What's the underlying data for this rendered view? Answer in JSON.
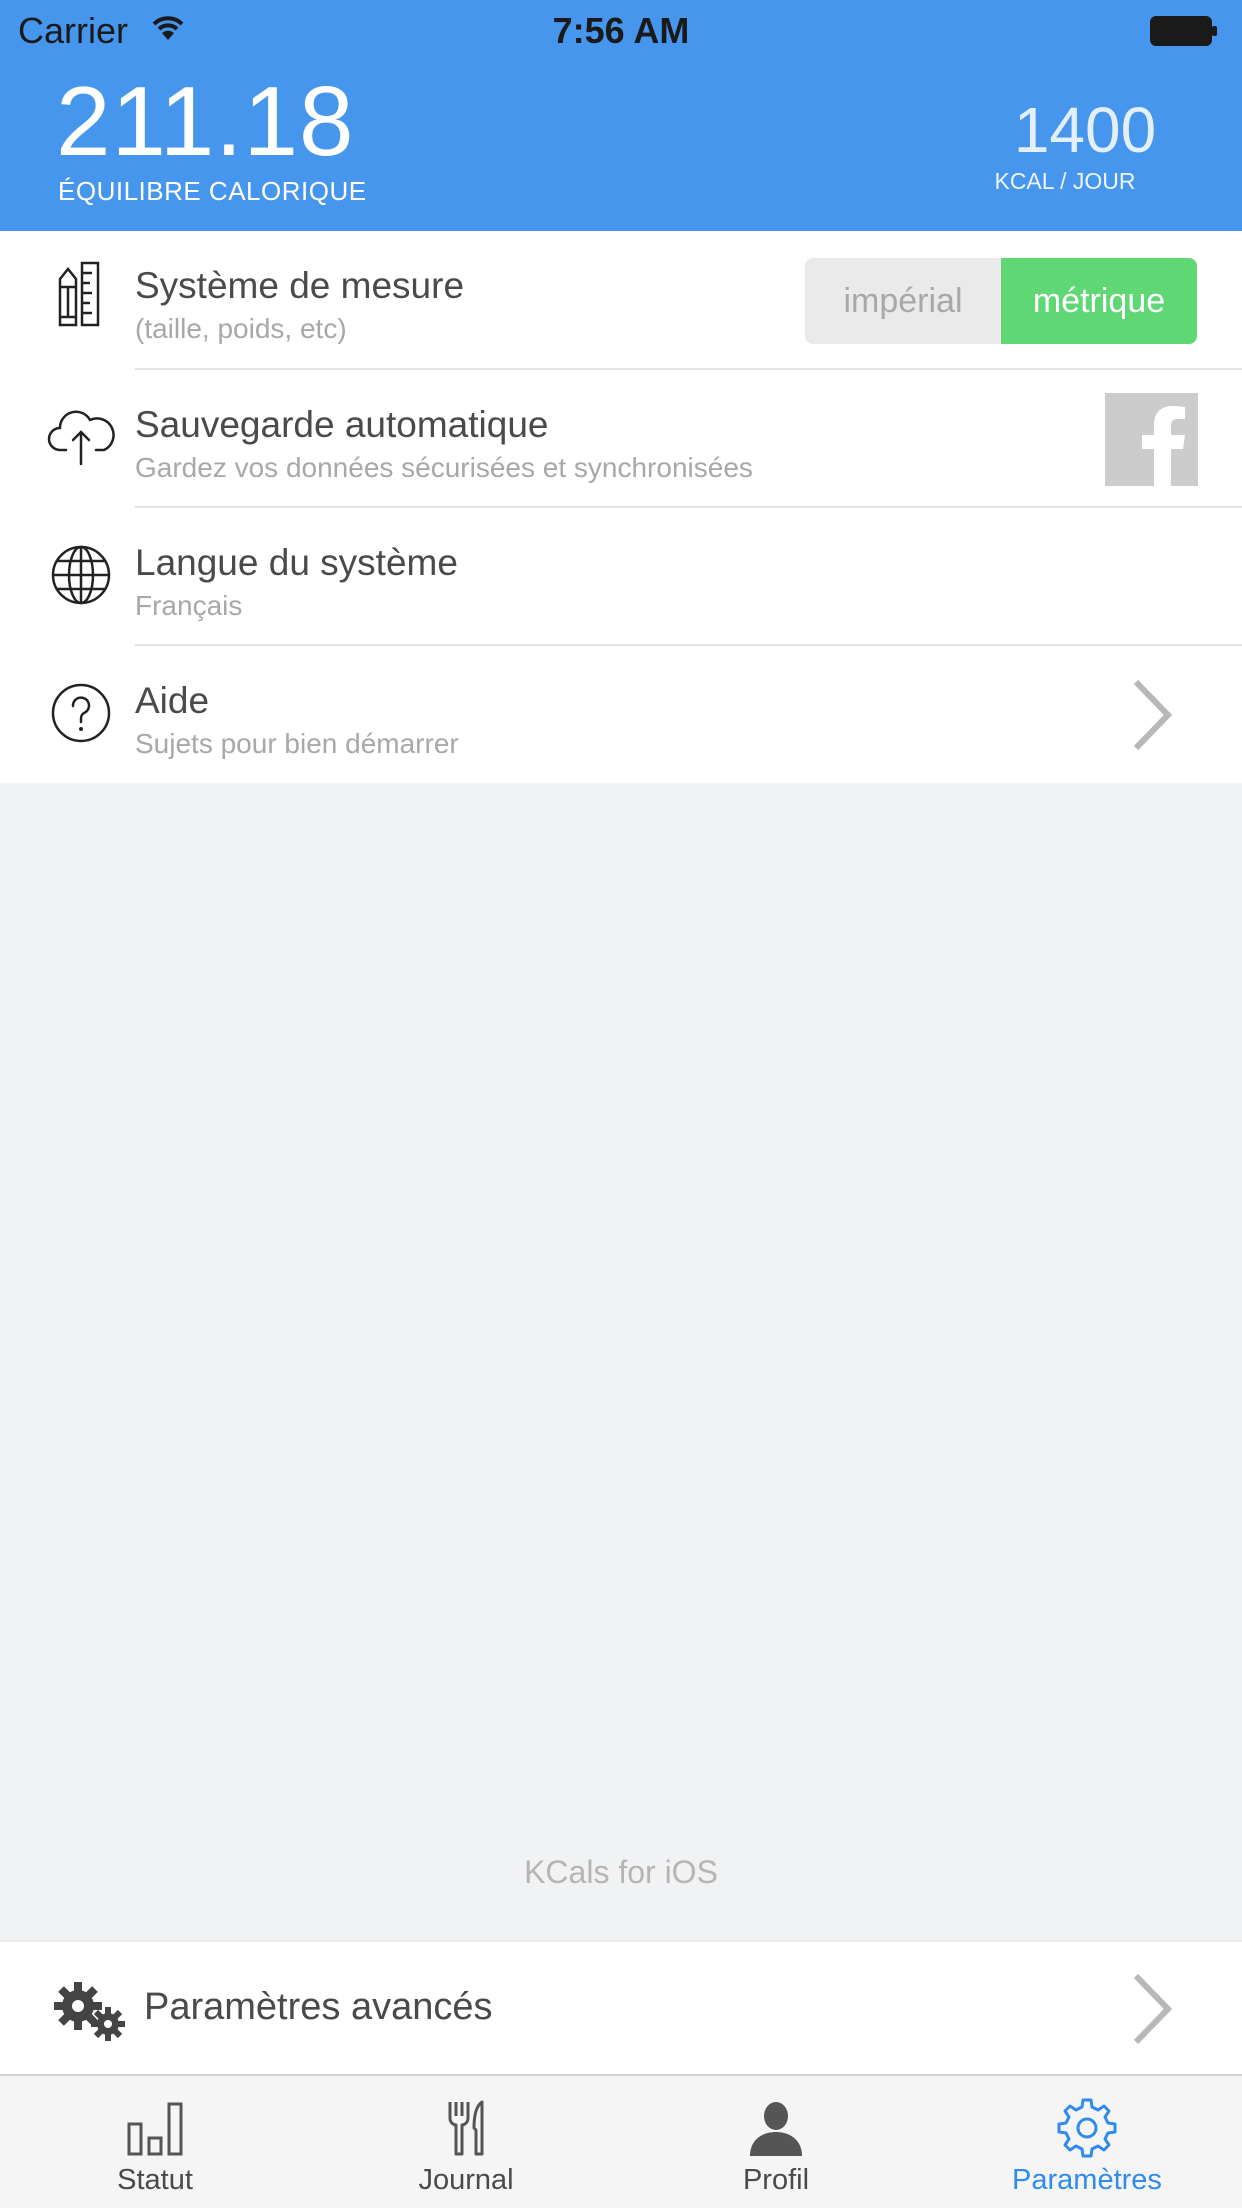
{
  "status_bar": {
    "carrier": "Carrier",
    "time": "7:56 AM",
    "wifi_icon": "wifi-icon",
    "battery_icon": "battery-icon"
  },
  "header": {
    "balance_value": "211.18",
    "balance_label": "ÉQUILIBRE CALORIQUE",
    "kcal_value": "1400",
    "kcal_label": "KCAL / JOUR",
    "background_color": "#4796ee"
  },
  "settings": {
    "measure": {
      "title": "Système de mesure",
      "subtitle": "(taille, poids, etc)",
      "icon": "ruler-pencil-icon",
      "options": [
        "impérial",
        "métrique"
      ],
      "selected": "métrique",
      "selected_color": "#5ed774"
    },
    "backup": {
      "title": "Sauvegarde automatique",
      "subtitle": "Gardez vos données sécurisées et synchronisées",
      "icon": "cloud-upload-icon",
      "action_icon": "facebook-icon"
    },
    "language": {
      "title": "Langue du système",
      "subtitle": "Français",
      "icon": "globe-icon"
    },
    "help": {
      "title": "Aide",
      "subtitle": "Sujets pour bien démarrer",
      "icon": "help-icon"
    }
  },
  "footer": {
    "app_name": "KCals for iOS"
  },
  "advanced": {
    "label": "Paramètres avancés",
    "icon": "gears-icon"
  },
  "tabbar": {
    "active_color": "#2f8bed",
    "tabs": [
      {
        "label": "Statut",
        "icon": "bar-chart-icon"
      },
      {
        "label": "Journal",
        "icon": "fork-knife-icon"
      },
      {
        "label": "Profil",
        "icon": "person-icon"
      },
      {
        "label": "Paramètres",
        "icon": "gear-icon"
      }
    ],
    "active_index": 3
  }
}
